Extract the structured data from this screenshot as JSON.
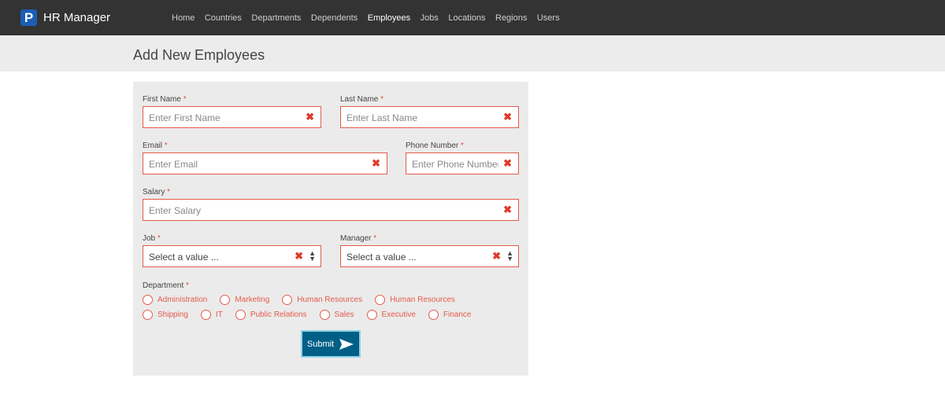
{
  "brand": {
    "logo_letter": "P",
    "name": "HR Manager",
    "logo_color": "#1a5fb4"
  },
  "nav": {
    "items": [
      {
        "label": "Home"
      },
      {
        "label": "Countries"
      },
      {
        "label": "Departments"
      },
      {
        "label": "Dependents"
      },
      {
        "label": "Employees",
        "active": true
      },
      {
        "label": "Jobs"
      },
      {
        "label": "Locations"
      },
      {
        "label": "Regions"
      },
      {
        "label": "Users"
      }
    ]
  },
  "page": {
    "title": "Add New Employees"
  },
  "form": {
    "required_mark": "*",
    "first_name": {
      "label": "First Name",
      "placeholder": "Enter First Name"
    },
    "last_name": {
      "label": "Last Name",
      "placeholder": "Enter Last Name"
    },
    "email": {
      "label": "Email",
      "placeholder": "Enter Email"
    },
    "phone": {
      "label": "Phone Number",
      "placeholder": "Enter Phone Number"
    },
    "salary": {
      "label": "Salary",
      "placeholder": "Enter Salary"
    },
    "job": {
      "label": "Job",
      "value": "Select a value ..."
    },
    "manager": {
      "label": "Manager",
      "value": "Select a value ..."
    },
    "department": {
      "label": "Department",
      "options_row1": [
        "Administration",
        "Marketing",
        "Human Resources",
        "Human Resources"
      ],
      "options_row2": [
        "Shipping",
        "IT",
        "Public Relations",
        "Sales",
        "Executive",
        "Finance"
      ]
    },
    "submit_label": "Submit",
    "clear_icon": "✖",
    "error_color": "#e45b4a",
    "submit_color": "#005f86"
  }
}
